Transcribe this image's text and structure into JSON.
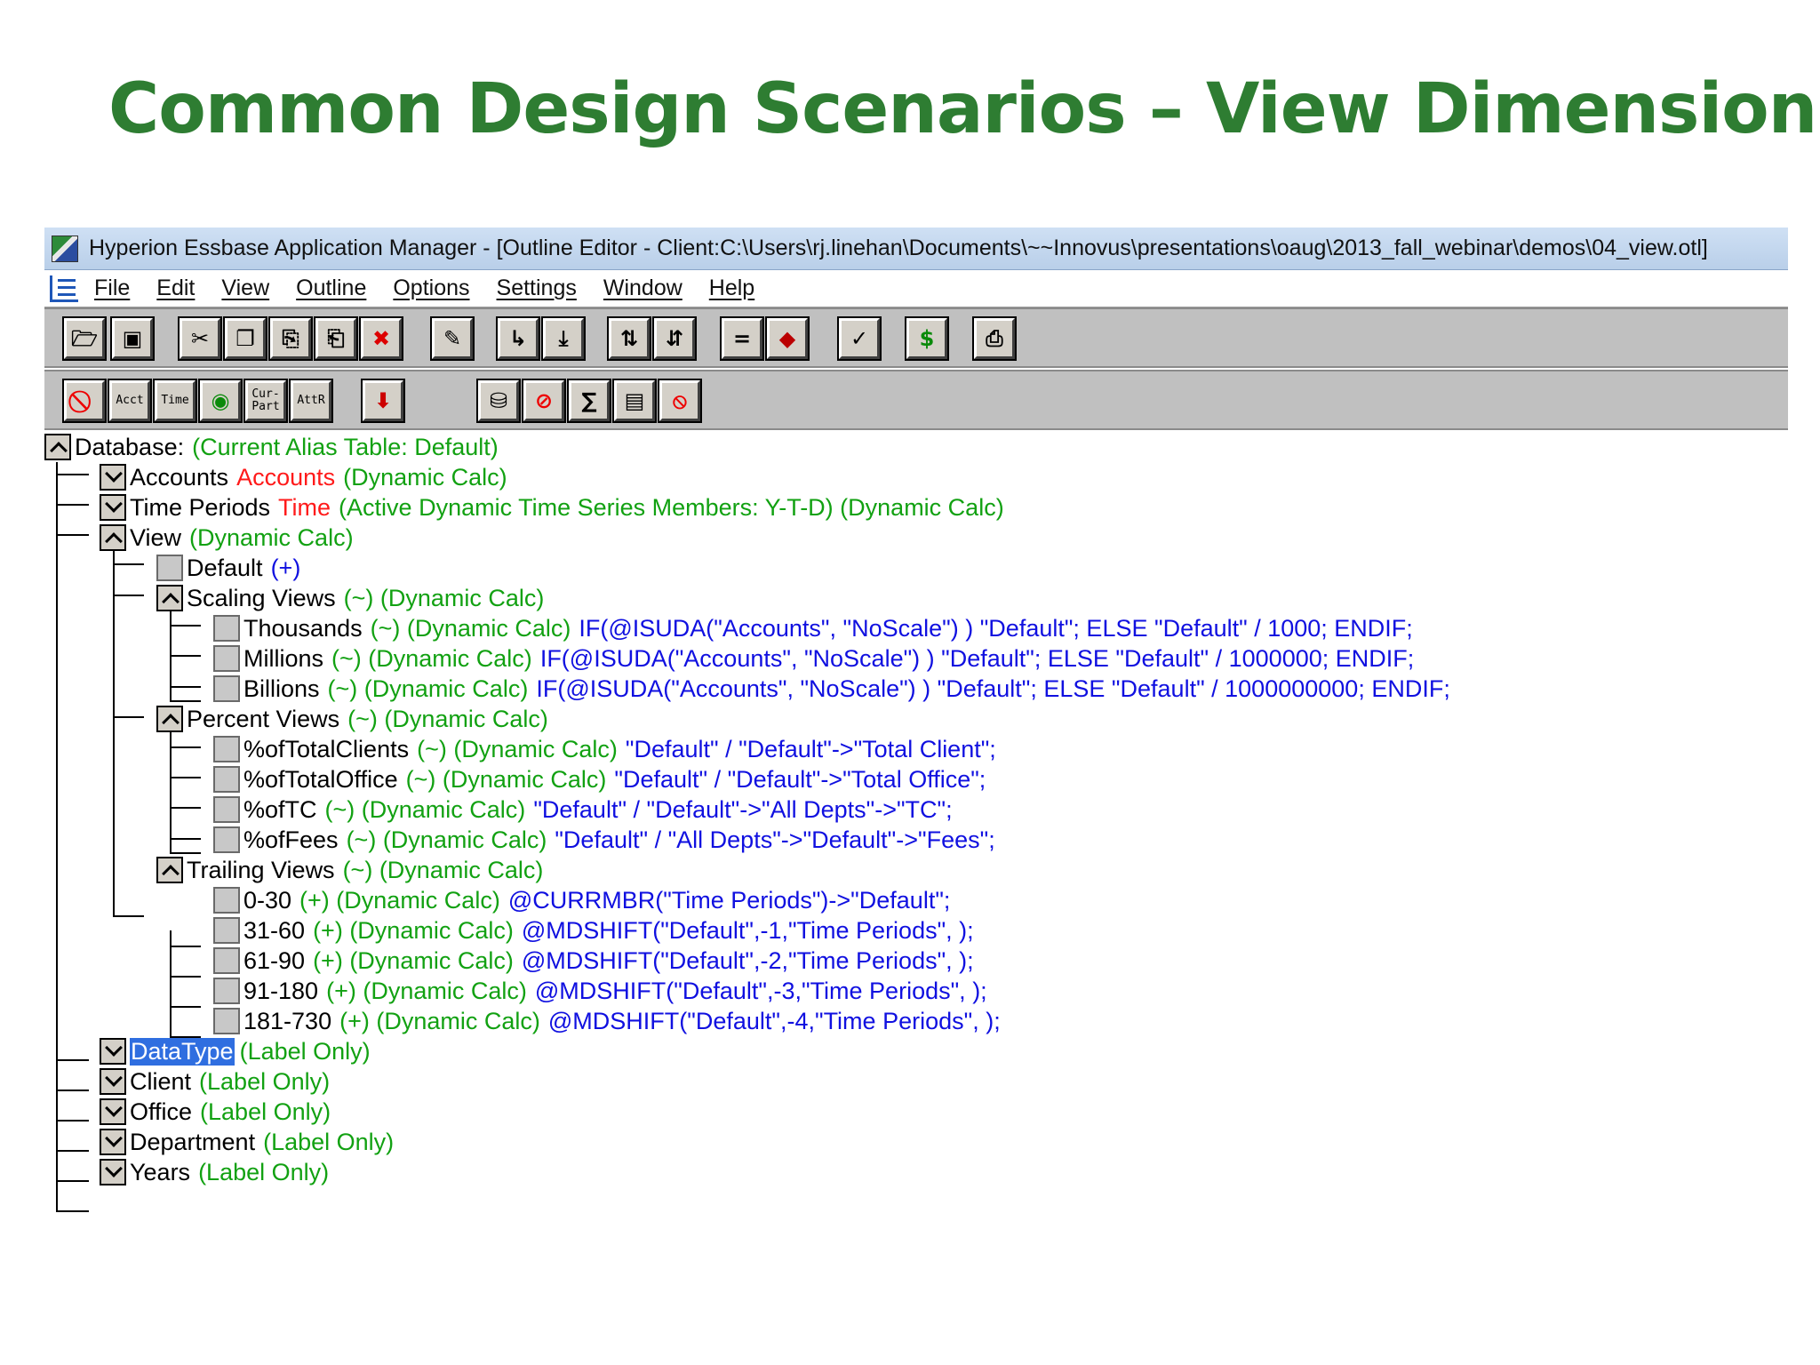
{
  "slide": {
    "title": "Common Design Scenarios – View Dimension"
  },
  "window": {
    "title": "Hyperion Essbase Application Manager - [Outline Editor - Client:C:\\Users\\rj.linehan\\Documents\\~~Innovus\\presentations\\oaug\\2013_fall_webinar\\demos\\04_view.otl]"
  },
  "menu": [
    "File",
    "Edit",
    "View",
    "Outline",
    "Options",
    "Settings",
    "Window",
    "Help"
  ],
  "toolbar2_labels": {
    "acct": "Acct",
    "time": "Time",
    "curpart": "Cur-Part",
    "attr": "AttR"
  },
  "outline": {
    "database": {
      "label": "Database:",
      "alias_table": "(Current Alias Table: Default)"
    },
    "accounts": {
      "name": "Accounts",
      "alias": "Accounts",
      "props": "(Dynamic Calc)"
    },
    "time": {
      "name": "Time Periods",
      "alias": "Time",
      "props": "(Active Dynamic Time Series Members: Y-T-D) (Dynamic Calc)"
    },
    "view": {
      "name": "View",
      "props": "(Dynamic Calc)"
    },
    "default": {
      "name": "Default",
      "props": "(+)"
    },
    "scaling": {
      "name": "Scaling Views",
      "props": "(~) (Dynamic Calc)"
    },
    "thousands": {
      "name": "Thousands",
      "props": "(~) (Dynamic Calc)",
      "formula": "IF(@ISUDA(\"Accounts\", \"NoScale\")  )   \"Default\";  ELSE   \"Default\" / 1000;  ENDIF;"
    },
    "millions": {
      "name": "Millions",
      "props": "(~) (Dynamic Calc)",
      "formula": "IF(@ISUDA(\"Accounts\", \"NoScale\")  )   \"Default\";  ELSE   \"Default\" / 1000000;  ENDIF;"
    },
    "billions": {
      "name": "Billions",
      "props": "(~) (Dynamic Calc)",
      "formula": "IF(@ISUDA(\"Accounts\", \"NoScale\")  )   \"Default\";  ELSE   \"Default\" / 1000000000;  ENDIF;"
    },
    "percent": {
      "name": "Percent Views",
      "props": "(~) (Dynamic Calc)"
    },
    "pct_clients": {
      "name": "%ofTotalClients",
      "props": "(~) (Dynamic Calc)",
      "formula": "\"Default\" / \"Default\"->\"Total Client\";"
    },
    "pct_office": {
      "name": "%ofTotalOffice",
      "props": "(~) (Dynamic Calc)",
      "formula": "\"Default\" / \"Default\"->\"Total Office\";"
    },
    "pct_tc": {
      "name": "%ofTC",
      "props": "(~) (Dynamic Calc)",
      "formula": "\"Default\" / \"Default\"->\"All Depts\"->\"TC\";"
    },
    "pct_fees": {
      "name": "%ofFees",
      "props": "(~) (Dynamic Calc)",
      "formula": "\"Default\" / \"All Depts\"->\"Default\"->\"Fees\";"
    },
    "trailing": {
      "name": "Trailing Views",
      "props": "(~) (Dynamic Calc)"
    },
    "t0_30": {
      "name": "0-30",
      "props": "(+) (Dynamic Calc)",
      "formula": "@CURRMBR(\"Time Periods\")->\"Default\";"
    },
    "t31_60": {
      "name": "31-60",
      "props": "(+) (Dynamic Calc)",
      "formula": "@MDSHIFT(\"Default\",-1,\"Time Periods\", );"
    },
    "t61_90": {
      "name": "61-90",
      "props": "(+) (Dynamic Calc)",
      "formula": "@MDSHIFT(\"Default\",-2,\"Time Periods\", );"
    },
    "t91_180": {
      "name": "91-180",
      "props": "(+) (Dynamic Calc)",
      "formula": "@MDSHIFT(\"Default\",-3,\"Time Periods\", );"
    },
    "t181_730": {
      "name": "181-730",
      "props": "(+) (Dynamic Calc)",
      "formula": "@MDSHIFT(\"Default\",-4,\"Time Periods\", );"
    },
    "datatype": {
      "name": "DataType",
      "props": "(Label Only)"
    },
    "client": {
      "name": "Client",
      "props": "(Label Only)"
    },
    "office": {
      "name": "Office",
      "props": "(Label Only)"
    },
    "department": {
      "name": "Department",
      "props": "(Label Only)"
    },
    "years": {
      "name": "Years",
      "props": "(Label Only)"
    }
  }
}
